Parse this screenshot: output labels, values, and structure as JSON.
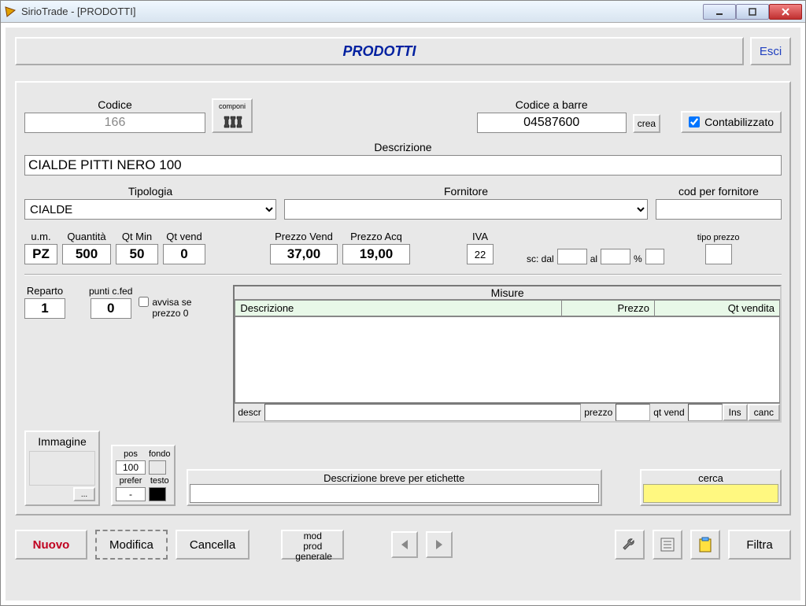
{
  "titlebar": "SirioTrade - [PRODOTTI]",
  "header": {
    "title": "PRODOTTI",
    "esci": "Esci"
  },
  "codice": {
    "label": "Codice",
    "value": "166"
  },
  "componi": "componi",
  "codice_barre": {
    "label": "Codice a barre",
    "value": "04587600",
    "crea": "crea"
  },
  "contabilizzato": {
    "label": "Contabilizzato",
    "checked": true
  },
  "descrizione": {
    "label": "Descrizione",
    "value": "CIALDE PITTI NERO 100"
  },
  "tipologia": {
    "label": "Tipologia",
    "value": "CIALDE"
  },
  "fornitore": {
    "label": "Fornitore",
    "value": ""
  },
  "cod_fornitore": {
    "label": "cod per fornitore",
    "value": ""
  },
  "um": {
    "label": "u.m.",
    "value": "PZ"
  },
  "quantita": {
    "label": "Quantità",
    "value": "500"
  },
  "qtmin": {
    "label": "Qt Min",
    "value": "50"
  },
  "qtvend": {
    "label": "Qt vend",
    "value": "0"
  },
  "prezzo_vend": {
    "label": "Prezzo Vend",
    "value": "37,00"
  },
  "prezzo_acq": {
    "label": "Prezzo Acq",
    "value": "19,00"
  },
  "iva": {
    "label": "IVA",
    "value": "22"
  },
  "sc": {
    "dal_lbl": "sc: dal",
    "al_lbl": "al",
    "pct_lbl": "%",
    "dal": "",
    "al": "",
    "pct": ""
  },
  "tipo_prezzo": {
    "label": "tipo prezzo",
    "value": ""
  },
  "reparto": {
    "label": "Reparto",
    "value": "1"
  },
  "punti": {
    "label": "punti c.fed",
    "value": "0"
  },
  "avvisa": {
    "label": "avvisa se prezzo 0"
  },
  "misure": {
    "title": "Misure",
    "col_descr": "Descrizione",
    "col_prezzo": "Prezzo",
    "col_qt": "Qt vendita",
    "descr_lbl": "descr",
    "prezzo_lbl": "prezzo",
    "qtvend_lbl": "qt vend",
    "ins": "Ins",
    "canc": "canc"
  },
  "immagine": {
    "label": "Immagine",
    "btn": "..."
  },
  "pos": {
    "pos_lbl": "pos",
    "pos_val": "100",
    "fondo_lbl": "fondo",
    "prefer_lbl": "prefer",
    "prefer_val": "-",
    "testo_lbl": "testo"
  },
  "descr_etichette": {
    "label": "Descrizione breve per etichette",
    "value": ""
  },
  "cerca": {
    "label": "cerca",
    "value": ""
  },
  "footer": {
    "nuovo": "Nuovo",
    "modifica": "Modifica",
    "cancella": "Cancella",
    "modprod": "mod prod generale",
    "filtra": "Filtra"
  }
}
